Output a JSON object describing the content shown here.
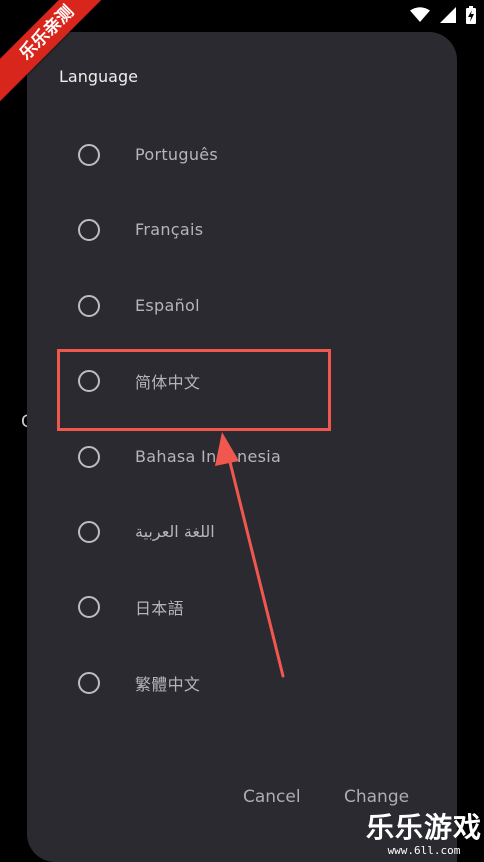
{
  "dialog": {
    "title": "Language",
    "options": [
      {
        "label": "Português",
        "selected": false
      },
      {
        "label": "Français",
        "selected": false
      },
      {
        "label": "Español",
        "selected": false
      },
      {
        "label": "简体中文",
        "selected": false
      },
      {
        "label": "Bahasa Indonesia",
        "selected": false
      },
      {
        "label": "اللغة العربية",
        "selected": false
      },
      {
        "label": "日本語",
        "selected": false
      },
      {
        "label": "繁體中文",
        "selected": false
      }
    ],
    "cancel_label": "Cancel",
    "change_label": "Change"
  },
  "background": {
    "partial_text": "C"
  },
  "watermark": {
    "ribbon_text": "乐乐亲测",
    "brand_text": "乐乐游戏",
    "url_text": "www.6ll.com"
  },
  "colors": {
    "dialog_background": "#2b2a30",
    "annotation_red": "#f0574e",
    "ribbon_red": "#d9261c"
  },
  "icons": {
    "wifi": "wifi-icon",
    "signal": "signal-icon",
    "battery": "battery-charging-icon"
  }
}
